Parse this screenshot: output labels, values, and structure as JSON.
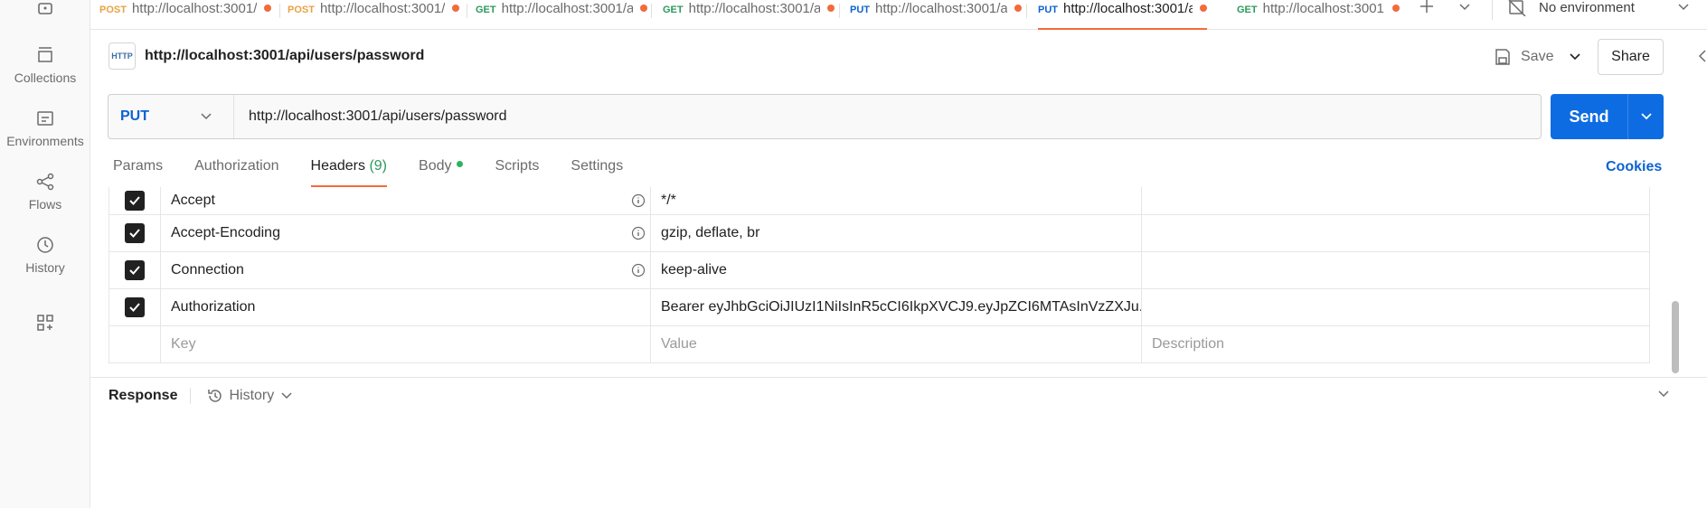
{
  "sidebar": {
    "items": [
      {
        "label": "Collections",
        "icon": "collections-icon"
      },
      {
        "label": "Environments",
        "icon": "environments-icon"
      },
      {
        "label": "Flows",
        "icon": "flows-icon"
      },
      {
        "label": "History",
        "icon": "history-icon"
      }
    ]
  },
  "tabs": [
    {
      "method": "POST",
      "url": "http://localhost:3001/",
      "unsaved": true,
      "active": false
    },
    {
      "method": "POST",
      "url": "http://localhost:3001/",
      "unsaved": true,
      "active": false
    },
    {
      "method": "GET",
      "url": "http://localhost:3001/a",
      "unsaved": true,
      "active": false
    },
    {
      "method": "GET",
      "url": "http://localhost:3001/a",
      "unsaved": true,
      "active": false
    },
    {
      "method": "PUT",
      "url": "http://localhost:3001/a",
      "unsaved": true,
      "active": false
    },
    {
      "method": "PUT",
      "url": "http://localhost:3001/a",
      "unsaved": true,
      "active": true
    },
    {
      "method": "GET",
      "url": "http://localhost:3001",
      "unsaved": true,
      "active": false
    }
  ],
  "environment": {
    "selected": "No environment"
  },
  "request": {
    "http_badge": "HTTP",
    "title": "http://localhost:3001/api/users/password",
    "method": "PUT",
    "url": "http://localhost:3001/api/users/password",
    "save_label": "Save",
    "share_label": "Share",
    "send_label": "Send"
  },
  "subtabs": {
    "params": "Params",
    "authorization": "Authorization",
    "headers": "Headers",
    "headers_count": "(9)",
    "body": "Body",
    "scripts": "Scripts",
    "settings": "Settings",
    "cookies": "Cookies"
  },
  "headers": [
    {
      "key": "Accept",
      "value": "*/*",
      "info": true
    },
    {
      "key": "Accept-Encoding",
      "value": "gzip, deflate, br",
      "info": true
    },
    {
      "key": "Connection",
      "value": "keep-alive",
      "info": true
    },
    {
      "key": "Authorization",
      "value": "Bearer eyJhbGciOiJIUzI1NiIsInR5cCI6IkpXVCJ9.eyJpZCI6MTAsInVzZXJu...",
      "info": false
    }
  ],
  "new_row": {
    "key_placeholder": "Key",
    "value_placeholder": "Value",
    "description_placeholder": "Description"
  },
  "response": {
    "title": "Response",
    "history_label": "History"
  },
  "colors": {
    "accent": "#f26b3a",
    "primary": "#0d6ce2",
    "get": "#2b9a5a",
    "post": "#e8a243",
    "put": "#0d63d2"
  }
}
